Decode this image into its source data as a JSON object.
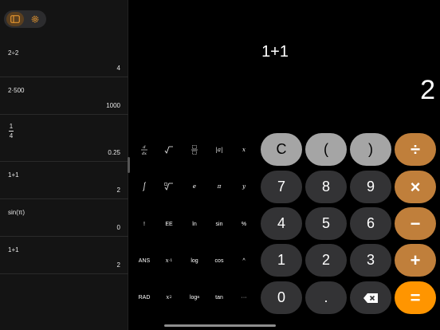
{
  "colors": {
    "background": "#000000",
    "sidebar": "#141414",
    "number_key": "#333335",
    "function_key": "#a5a5a5",
    "operator_key": "#c07f3b",
    "equals_key": "#ff9500"
  },
  "toolbar": {
    "sidebar_icon": "sidebar-icon",
    "settings_icon": "gear-icon"
  },
  "history": [
    {
      "expression": "2÷2",
      "result": "4"
    },
    {
      "expression": "2·500",
      "result": "1000"
    },
    {
      "numerator": "1",
      "denominator": "4",
      "result": "0.25"
    },
    {
      "expression": "1+1",
      "result": "2"
    },
    {
      "expression": "sin(π)",
      "result": "0"
    },
    {
      "expression": "1+1",
      "result": "2"
    }
  ],
  "display": {
    "expression": "1+1",
    "result": "2"
  },
  "functions": {
    "abs": "|a|",
    "x": "x",
    "e": "e",
    "pi": "π",
    "y": "y",
    "factorial": "!",
    "ee": "EE",
    "ln": "ln",
    "sin": "sin",
    "percent": "%",
    "ans": "ANS",
    "log": "log",
    "cos": "cos",
    "power": "^",
    "rad": "RAD",
    "log_base": "log",
    "log_sub": "a",
    "tan": "tan",
    "more": "···",
    "inverse_base": "x",
    "inverse_exp": "-1",
    "square_base": "x",
    "square_exp": "2"
  },
  "keys": {
    "clear": "C",
    "open_paren": "(",
    "close_paren": ")",
    "divide": "÷",
    "seven": "7",
    "eight": "8",
    "nine": "9",
    "multiply": "×",
    "four": "4",
    "five": "5",
    "six": "6",
    "subtract": "−",
    "one": "1",
    "two": "2",
    "three": "3",
    "add": "+",
    "zero": "0",
    "decimal": ".",
    "equals": "="
  }
}
